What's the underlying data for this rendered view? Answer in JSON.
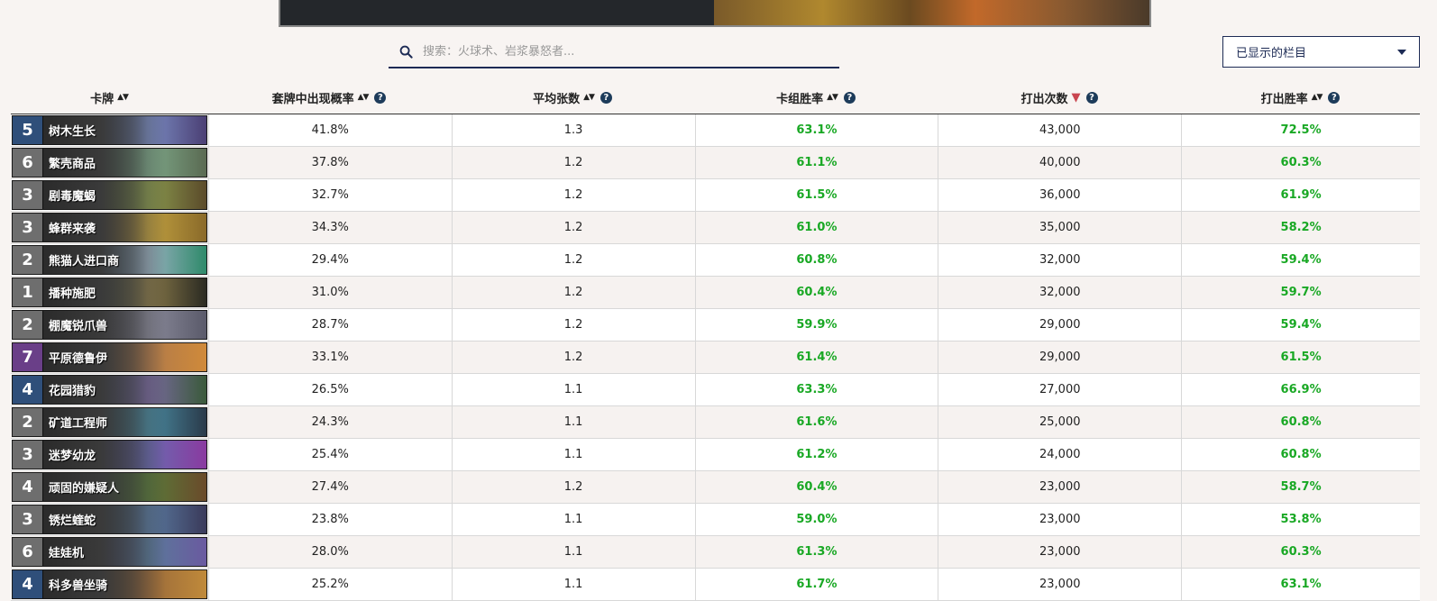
{
  "search": {
    "placeholder": "搜索：火球术、岩浆暴怒者..."
  },
  "columns_dropdown": {
    "label": "已显示的栏目"
  },
  "headers": {
    "card": "卡牌",
    "inclusion": "套牌中出现概率",
    "avg_copies": "平均张数",
    "deck_winrate": "卡组胜率",
    "times_played": "打出次数",
    "played_winrate": "打出胜率"
  },
  "colors": {
    "positive": "#19a824",
    "header_dark": "#1d2b55",
    "sort_active": "#c9454f"
  },
  "rows": [
    {
      "cost": "5",
      "name": "树木生长",
      "inclusion": "41.8%",
      "avg": "1.3",
      "deck_wr": "63.1%",
      "played": "43,000",
      "played_wr": "72.5%"
    },
    {
      "cost": "6",
      "name": "繁壳商品",
      "inclusion": "37.8%",
      "avg": "1.2",
      "deck_wr": "61.1%",
      "played": "40,000",
      "played_wr": "60.3%"
    },
    {
      "cost": "3",
      "name": "剧毒魔蝎",
      "inclusion": "32.7%",
      "avg": "1.2",
      "deck_wr": "61.5%",
      "played": "36,000",
      "played_wr": "61.9%"
    },
    {
      "cost": "3",
      "name": "蜂群来袭",
      "inclusion": "34.3%",
      "avg": "1.2",
      "deck_wr": "61.0%",
      "played": "35,000",
      "played_wr": "58.2%"
    },
    {
      "cost": "2",
      "name": "熊猫人进口商",
      "inclusion": "29.4%",
      "avg": "1.2",
      "deck_wr": "60.8%",
      "played": "32,000",
      "played_wr": "59.4%"
    },
    {
      "cost": "1",
      "name": "播种施肥",
      "inclusion": "31.0%",
      "avg": "1.2",
      "deck_wr": "60.4%",
      "played": "32,000",
      "played_wr": "59.7%"
    },
    {
      "cost": "2",
      "name": "棚魔锐爪兽",
      "inclusion": "28.7%",
      "avg": "1.2",
      "deck_wr": "59.9%",
      "played": "29,000",
      "played_wr": "59.4%"
    },
    {
      "cost": "7",
      "name": "平原德鲁伊",
      "inclusion": "33.1%",
      "avg": "1.2",
      "deck_wr": "61.4%",
      "played": "29,000",
      "played_wr": "61.5%"
    },
    {
      "cost": "4",
      "name": "花园猎豹",
      "inclusion": "26.5%",
      "avg": "1.1",
      "deck_wr": "63.3%",
      "played": "27,000",
      "played_wr": "66.9%"
    },
    {
      "cost": "2",
      "name": "矿道工程师",
      "inclusion": "24.3%",
      "avg": "1.1",
      "deck_wr": "61.6%",
      "played": "25,000",
      "played_wr": "60.8%"
    },
    {
      "cost": "3",
      "name": "迷梦幼龙",
      "inclusion": "25.4%",
      "avg": "1.1",
      "deck_wr": "61.2%",
      "played": "24,000",
      "played_wr": "60.8%"
    },
    {
      "cost": "4",
      "name": "顽固的嫌疑人",
      "inclusion": "27.4%",
      "avg": "1.2",
      "deck_wr": "60.4%",
      "played": "23,000",
      "played_wr": "58.7%"
    },
    {
      "cost": "3",
      "name": "锈烂蝰蛇",
      "inclusion": "23.8%",
      "avg": "1.1",
      "deck_wr": "59.0%",
      "played": "23,000",
      "played_wr": "53.8%"
    },
    {
      "cost": "6",
      "name": "娃娃机",
      "inclusion": "28.0%",
      "avg": "1.1",
      "deck_wr": "61.3%",
      "played": "23,000",
      "played_wr": "60.3%"
    },
    {
      "cost": "4",
      "name": "科多兽坐骑",
      "inclusion": "25.2%",
      "avg": "1.1",
      "deck_wr": "61.7%",
      "played": "23,000",
      "played_wr": "63.1%"
    }
  ]
}
